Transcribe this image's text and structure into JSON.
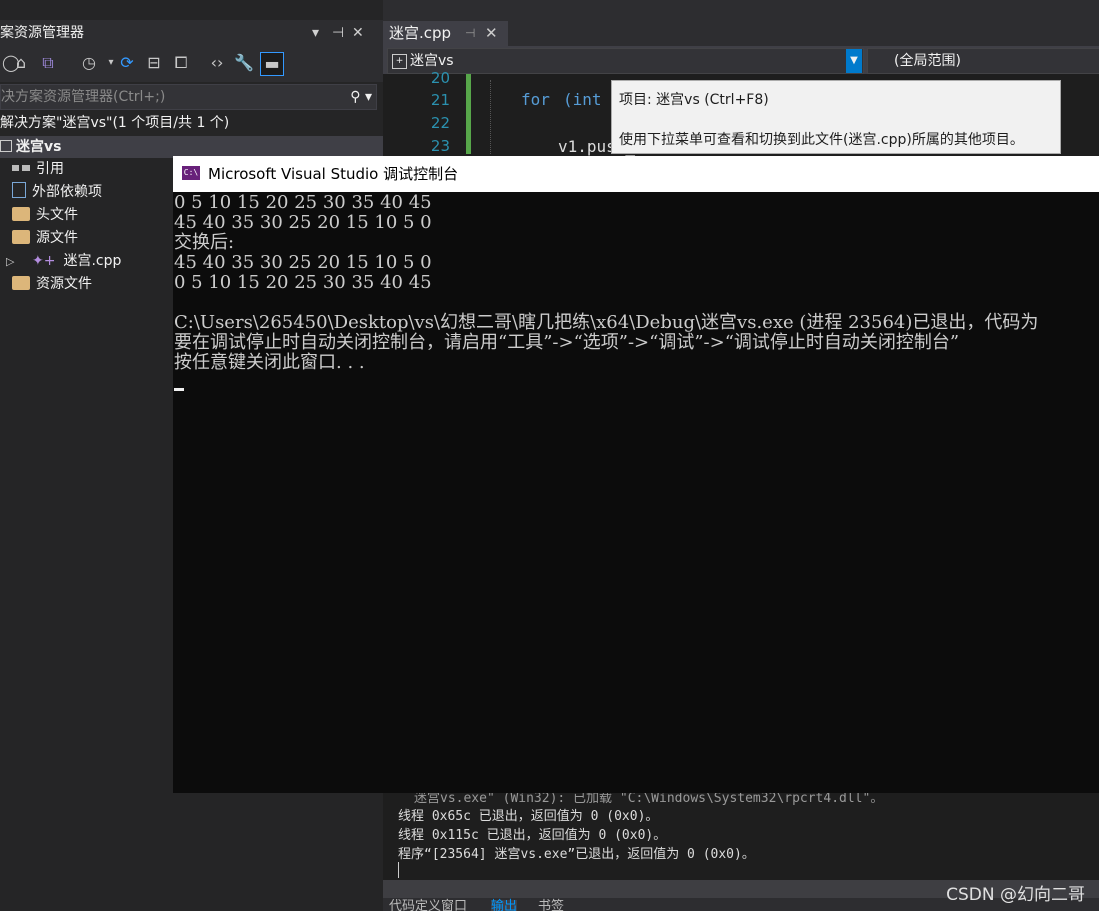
{
  "solution_explorer": {
    "title": "案资源管理器",
    "title_icons": [
      "chevron-down-icon",
      "pin-icon",
      "close-icon"
    ],
    "toolbar_icons": [
      "back-icon",
      "home-icon",
      "switch-views-icon",
      "history-icon",
      "sync-icon",
      "collapse-all-icon",
      "show-all-files-icon",
      "view-code-icon",
      "properties-icon",
      "preview-icon"
    ],
    "search_placeholder": "决方案资源管理器(Ctrl+;)",
    "solution_line": "解决方案\"迷宫vs\"(1 个项目/共 1 个)",
    "project": "迷宫vs",
    "items": [
      {
        "label": "引用",
        "icon": "references-icon"
      },
      {
        "label": "外部依赖项",
        "icon": "external-dependencies-icon"
      },
      {
        "label": "头文件",
        "icon": "folder-icon"
      },
      {
        "label": "源文件",
        "icon": "folder-icon"
      },
      {
        "label": "迷宫.cpp",
        "icon": "cpp-file-icon"
      },
      {
        "label": "资源文件",
        "icon": "folder-icon"
      }
    ]
  },
  "editor": {
    "tab": "迷宫.cpp",
    "nav_project": "迷宫vs",
    "nav_scope": "(全局范围)",
    "line_numbers": [
      "20",
      "21",
      "22",
      "23"
    ],
    "code_for": "for",
    "code_int": "(int i",
    "code_push": "v1.push_"
  },
  "tooltip": {
    "line1": "项目: 迷宫vs (Ctrl+F8)",
    "line2": "使用下拉菜单可查看和切换到此文件(迷宫.cpp)所属的其他项目。"
  },
  "console": {
    "title": "Microsoft Visual Studio 调试控制台",
    "lines": [
      "0 5 10 15 20 25 30 35 40 45",
      "45 40 35 30 25 20 15 10 5 0",
      "交换后:",
      "45 40 35 30 25 20 15 10 5 0",
      "0 5 10 15 20 25 30 35 40 45",
      "",
      "C:\\Users\\265450\\Desktop\\vs\\幻想二哥\\瞎几把练\\x64\\Debug\\迷宫vs.exe (进程 23564)已退出，代码为",
      "要在调试停止时自动关闭控制台，请启用“工具”->“选项”->“调试”->“调试停止时自动关闭控制台”",
      "按任意键关闭此窗口. . ."
    ]
  },
  "output": {
    "lines": [
      "迷宫vs.exe\" (Win32): 已加载 \"C:\\Windows\\System32\\rpcrt4.dll\"。",
      "线程 0x65c 已退出，返回值为 0 (0x0)。",
      "线程 0x115c 已退出，返回值为 0 (0x0)。",
      "程序“[23564] 迷宫vs.exe”已退出，返回值为 0 (0x0)。"
    ]
  },
  "bottom_tabs": [
    "代码定义窗口",
    "输出",
    "书签"
  ],
  "watermark": "CSDN @幻向二哥",
  "colors": {
    "vs_blue": "#007acc",
    "keyword": "#569cd6",
    "line_number": "#2b91af",
    "changed_bar": "#57a64a",
    "console_bg": "#0c0c0c"
  }
}
